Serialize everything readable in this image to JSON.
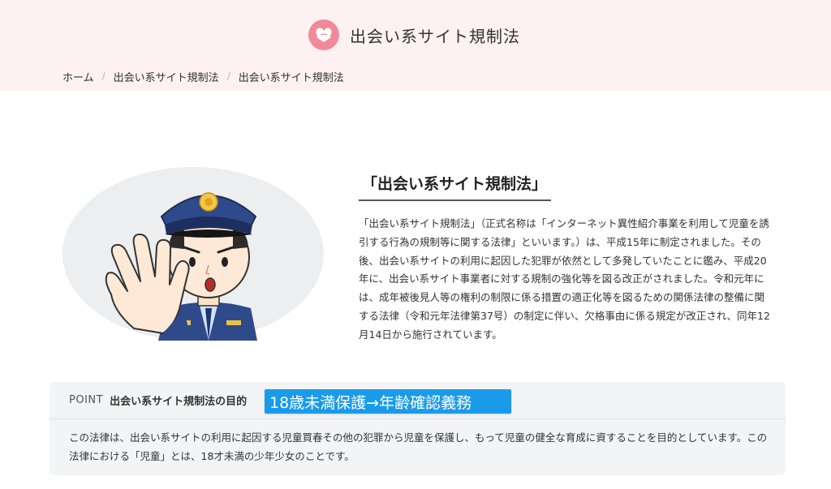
{
  "site": {
    "title": "出会い系サイト規制法",
    "logo_icon": "heart-hands-icon",
    "brand_color": "#f08a9b",
    "header_bg": "#fdf1f1"
  },
  "breadcrumb": [
    {
      "label": "ホーム"
    },
    {
      "label": "出会い系サイト規制法"
    },
    {
      "label": "出会い系サイト規制法"
    }
  ],
  "article": {
    "illustration": "police-officer-stop-gesture",
    "heading": "「出会い系サイト規制法」",
    "body": "「出会い系サイト規制法」（正式名称は「インターネット異性紹介事業を利用して児童を誘引する行為の規制等に関する法律」といいます。）は、平成15年に制定されました。その後、出会い系サイトの利用に起因した犯罪が依然として多発していたことに鑑み、平成20年に、出会い系サイト事業者に対する規制の強化等を図る改正がされました。令和元年には、成年被後見人等の権利の制限に係る措置の適正化等を図るための関係法律の整備に関する法律（令和元年法律第37号）の制定に伴い、欠格事由に係る規定が改正され、同年12月14日から施行されています。"
  },
  "point": {
    "tag": "POINT",
    "title": "出会い系サイト規制法の目的",
    "highlight": "18歳未満保護→年齢確認義務",
    "highlight_color": "#1a9bea",
    "body": "この法律は、出会い系サイトの利用に起因する児童買春その他の犯罪から児童を保護し、もって児童の健全な育成に資することを目的としています。この法律における「児童」とは、18才未満の少年少女のことです。"
  }
}
